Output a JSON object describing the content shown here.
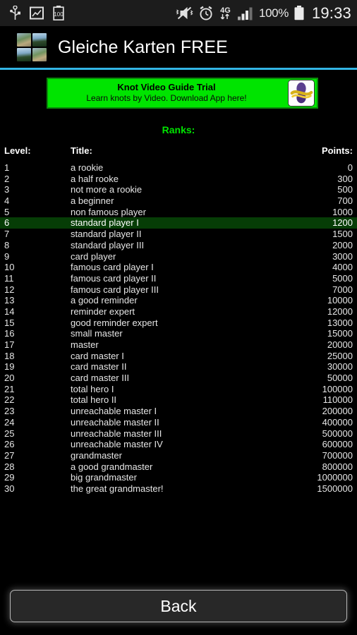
{
  "status_bar": {
    "left_icons": [
      {
        "name": "usb-icon",
        "glyph": "usb"
      },
      {
        "name": "screenshot-icon",
        "glyph": "image"
      },
      {
        "name": "battery-percent-icon",
        "glyph": "100"
      }
    ],
    "right_icons": [
      {
        "name": "mute-vibrate-icon",
        "glyph": "mute"
      },
      {
        "name": "alarm-clock-icon",
        "glyph": "alarm"
      },
      {
        "name": "network-4g-icon",
        "glyph": "4G"
      },
      {
        "name": "signal-bars-icon",
        "glyph": "signal"
      }
    ],
    "battery_percent": "100%",
    "clock": "19:33"
  },
  "action_bar": {
    "app_icon_name": "app-icon-memory-cards",
    "title": "Gleiche Karten FREE",
    "accent_color": "#33b5e5"
  },
  "ad": {
    "title": "Knot Video Guide Trial",
    "subtitle": "Learn knots by Video. Download App here!",
    "background_color": "#00e400",
    "thumb_name": "knot-app-thumbnail"
  },
  "ranks": {
    "heading": "Ranks:",
    "heading_color": "#00e400",
    "highlight_color": "#063d06",
    "current_level": 6,
    "columns": {
      "level": "Level:",
      "title": "Title:",
      "points": "Points:"
    },
    "rows": [
      {
        "level": "1",
        "title": "a rookie",
        "points": "0"
      },
      {
        "level": "2",
        "title": "a half rooke",
        "points": "300"
      },
      {
        "level": "3",
        "title": "not more a rookie",
        "points": "500"
      },
      {
        "level": "4",
        "title": "a beginner",
        "points": "700"
      },
      {
        "level": "5",
        "title": "non famous player",
        "points": "1000"
      },
      {
        "level": "6",
        "title": "standard player I",
        "points": "1200"
      },
      {
        "level": "7",
        "title": "standard player II",
        "points": "1500"
      },
      {
        "level": "8",
        "title": "standard player III",
        "points": "2000"
      },
      {
        "level": "9",
        "title": "card player",
        "points": "3000"
      },
      {
        "level": "10",
        "title": "famous card player I",
        "points": "4000"
      },
      {
        "level": "11",
        "title": "famous card player II",
        "points": "5000"
      },
      {
        "level": "12",
        "title": "famous card player III",
        "points": "7000"
      },
      {
        "level": "13",
        "title": "a good reminder",
        "points": "10000"
      },
      {
        "level": "14",
        "title": "reminder expert",
        "points": "12000"
      },
      {
        "level": "15",
        "title": "good reminder expert",
        "points": "13000"
      },
      {
        "level": "16",
        "title": "small master",
        "points": "15000"
      },
      {
        "level": "17",
        "title": "master",
        "points": "20000"
      },
      {
        "level": "18",
        "title": "card master I",
        "points": "25000"
      },
      {
        "level": "19",
        "title": "card master II",
        "points": "30000"
      },
      {
        "level": "20",
        "title": "card master III",
        "points": "50000"
      },
      {
        "level": "21",
        "title": "total hero I",
        "points": "100000"
      },
      {
        "level": "22",
        "title": "total hero II",
        "points": "110000"
      },
      {
        "level": "23",
        "title": "unreachable master I",
        "points": "200000"
      },
      {
        "level": "24",
        "title": "unreachable master II",
        "points": "400000"
      },
      {
        "level": "25",
        "title": "unreachable master III",
        "points": "500000"
      },
      {
        "level": "26",
        "title": "unreachable master IV",
        "points": "600000"
      },
      {
        "level": "27",
        "title": "grandmaster",
        "points": "700000"
      },
      {
        "level": "28",
        "title": "a good grandmaster",
        "points": "800000"
      },
      {
        "level": "29",
        "title": "big grandmaster",
        "points": "1000000"
      },
      {
        "level": "30",
        "title": "the great grandmaster!",
        "points": "1500000"
      }
    ]
  },
  "footer": {
    "back_label": "Back"
  }
}
